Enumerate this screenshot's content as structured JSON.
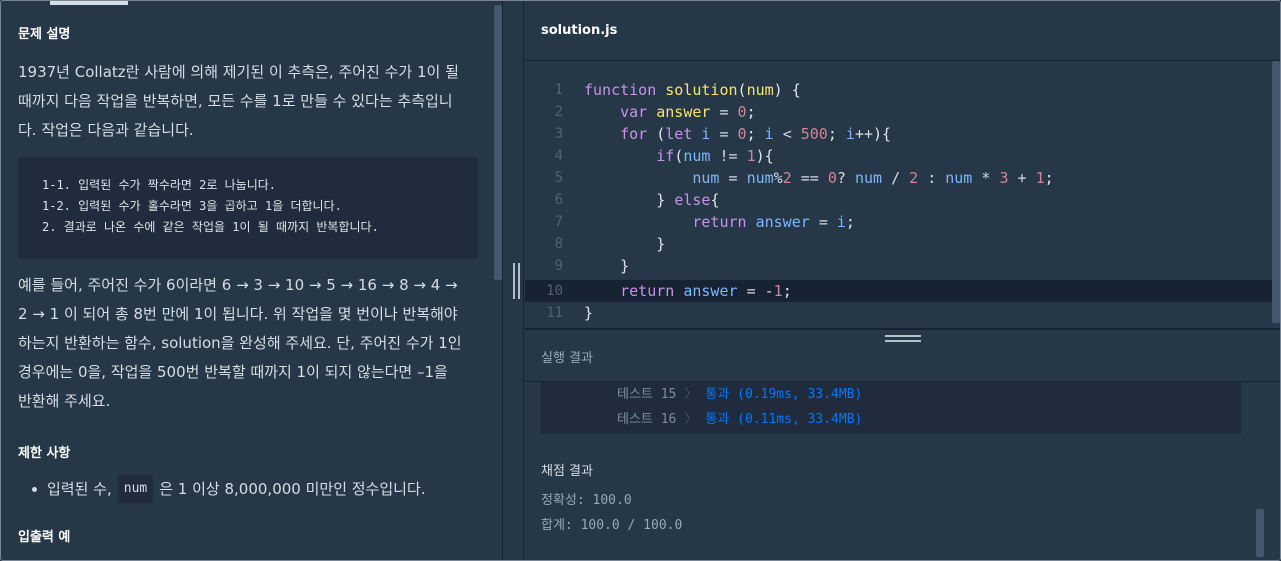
{
  "problem": {
    "section_title": "문제 설명",
    "desc_line1": "1937년 Collatz란 사람에 의해 제기된 이 추측은, 주어진 수가 1이 될",
    "desc_line2": "때까지 다음 작업을 반복하면, 모든 수를 1로 만들 수 있다는 추측입니",
    "desc_line3": "다. 작업은 다음과 같습니다.",
    "steps": [
      "1-1. 입력된 수가 짝수라면 2로 나눕니다.",
      "1-2. 입력된 수가 홀수라면 3을 곱하고 1을 더합니다.",
      "2. 결과로 나온 수에 같은 작업을 1이 될 때까지 반복합니다."
    ],
    "example_lines": [
      "예를 들어, 주어진 수가 6이라면 6 → 3 → 10 → 5 → 16 → 8 → 4 →",
      "2 → 1 이 되어 총 8번 만에 1이 됩니다. 위 작업을 몇 번이나 반복해야",
      "하는지 반환하는 함수, solution을 완성해 주세요. 단, 주어진 수가 1인",
      "경우에는 0을, 작업을 500번 반복할 때까지 1이 되지 않는다면 –1을",
      "반환해 주세요."
    ],
    "constraints_title": "제한 사항",
    "constraint_prefix": "입력된 수,",
    "constraint_code": "num",
    "constraint_suffix": "은 1 이상 8,000,000 미만인 정수입니다.",
    "io_title": "입출력 예"
  },
  "editor": {
    "filename": "solution.js",
    "line_numbers": [
      "1",
      "2",
      "3",
      "4",
      "5",
      "6",
      "7",
      "8",
      "9",
      "10",
      "11"
    ]
  },
  "results": {
    "title": "실행 결과",
    "tests": [
      {
        "label": "테스트 15",
        "sep": "〉",
        "result": "통과 (0.19ms, 33.4MB)"
      },
      {
        "label": "테스트 16",
        "sep": "〉",
        "result": "통과 (0.11ms, 33.4MB)"
      }
    ],
    "grade_title": "채점 결과",
    "accuracy": "정확성: 100.0",
    "total": "합계: 100.0 / 100.0"
  }
}
